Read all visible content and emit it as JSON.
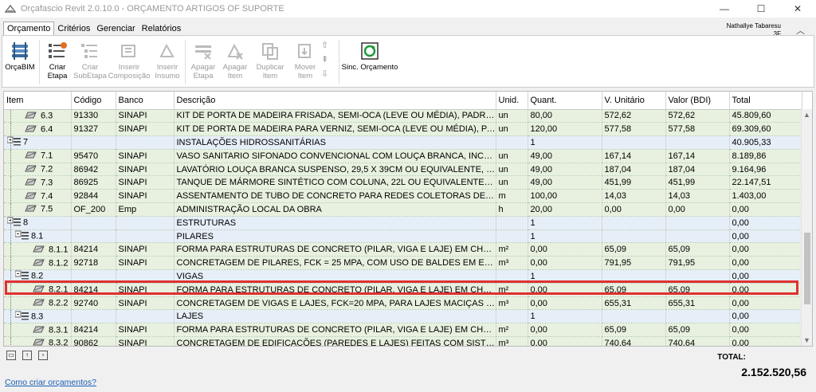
{
  "window": {
    "title": "Orçafascio Revit  2.0.10.0 - ORÇAMENTO ARTIGOS OF SUPORTE",
    "minimize": "—",
    "maximize": "☐",
    "close": "✕"
  },
  "menu": [
    "Orçamento",
    "Critérios",
    "Gerenciar",
    "Relatórios"
  ],
  "user": {
    "name": "Nathallye Tabaresu",
    "sub": "3F"
  },
  "ribbon": {
    "orcabim": "OrçaBIM",
    "criar_etapa": [
      "Criar",
      "Etapa"
    ],
    "criar_subetapa": [
      "Criar",
      "SubEtapa"
    ],
    "inserir_composicao": [
      "Inserir",
      "Composição"
    ],
    "inserir_insumo": [
      "Inserir",
      "Insumo"
    ],
    "apagar_etapa": [
      "Apagar",
      "Etapa"
    ],
    "apagar_item": [
      "Apagar",
      "Item"
    ],
    "duplicar_item": [
      "Duplicar",
      "Item"
    ],
    "mover_item": [
      "Mover",
      "Item"
    ],
    "sinc_orcamento": "Sinc. Orçamento"
  },
  "columns": [
    "Item",
    "Código",
    "Banco",
    "Descrição",
    "Unid.",
    "Quant.",
    "V. Unitário",
    "Valor (BDI)",
    "Total"
  ],
  "rows": [
    {
      "item": "6.3",
      "level": 2,
      "type": "leaf",
      "codigo": "91330",
      "banco": "SINAPI",
      "desc": "KIT DE PORTA DE MADEIRA FRISADA, SEMI-OCA (LEVE OU MÉDIA), PADRÃO MÉDIO, 70...",
      "unid": "un",
      "quant": "80,00",
      "vunit": "572,62",
      "valor": "572,62",
      "total": "45.809,60"
    },
    {
      "item": "6.4",
      "level": 2,
      "type": "leaf",
      "codigo": "91327",
      "banco": "SINAPI",
      "desc": "KIT DE PORTA DE MADEIRA PARA VERNIZ, SEMI-OCA (LEVE OU MÉDIA), PADRÃO POPU...",
      "unid": "un",
      "quant": "120,00",
      "vunit": "577,58",
      "valor": "577,58",
      "total": "69.309,60"
    },
    {
      "item": "7",
      "level": 0,
      "type": "group",
      "codigo": "",
      "banco": "",
      "desc": "INSTALAÇÕES HIDROSSANITÁRIAS",
      "unid": "",
      "quant": "1",
      "vunit": "",
      "valor": "",
      "total": "40.905,33"
    },
    {
      "item": "7.1",
      "level": 2,
      "type": "leaf",
      "codigo": "95470",
      "banco": "SINAPI",
      "desc": "VASO SANITARIO SIFONADO CONVENCIONAL COM LOUÇA BRANCA, INCLUSO CONJU...",
      "unid": "un",
      "quant": "49,00",
      "vunit": "167,14",
      "valor": "167,14",
      "total": "8.189,86"
    },
    {
      "item": "7.2",
      "level": 2,
      "type": "leaf",
      "codigo": "86942",
      "banco": "SINAPI",
      "desc": "LAVATÓRIO LOUÇA BRANCA SUSPENSO, 29,5 X 39CM OU EQUIVALENTE, PADRÃO POP...",
      "unid": "un",
      "quant": "49,00",
      "vunit": "187,04",
      "valor": "187,04",
      "total": "9.164,96"
    },
    {
      "item": "7.3",
      "level": 2,
      "type": "leaf",
      "codigo": "86925",
      "banco": "SINAPI",
      "desc": "TANQUE DE MÁRMORE SINTÉTICO COM COLUNA, 22L OU EQUIVALENTE, INCLUSO SIFÃ...",
      "unid": "un",
      "quant": "49,00",
      "vunit": "451,99",
      "valor": "451,99",
      "total": "22.147,51"
    },
    {
      "item": "7.4",
      "level": 2,
      "type": "leaf",
      "codigo": "92844",
      "banco": "SINAPI",
      "desc": "ASSENTAMENTO DE TUBO DE CONCRETO PARA REDES COLETORAS DE ESGOTO SANITÁ...",
      "unid": "m",
      "quant": "100,00",
      "vunit": "14,03",
      "valor": "14,03",
      "total": "1.403,00"
    },
    {
      "item": "7.5",
      "level": 2,
      "type": "leaf",
      "codigo": "OF_200",
      "banco": "Emp",
      "desc": "ADMINISTRAÇÃO LOCAL DA OBRA",
      "unid": "h",
      "quant": "20,00",
      "vunit": "0,00",
      "valor": "0,00",
      "total": "0,00"
    },
    {
      "item": "8",
      "level": 0,
      "type": "group",
      "codigo": "",
      "banco": "",
      "desc": "ESTRUTURAS",
      "unid": "",
      "quant": "1",
      "vunit": "",
      "valor": "",
      "total": "0,00"
    },
    {
      "item": "8.1",
      "level": 1,
      "type": "group",
      "codigo": "",
      "banco": "",
      "desc": "PILARES",
      "unid": "",
      "quant": "1",
      "vunit": "",
      "valor": "",
      "total": "0,00"
    },
    {
      "item": "8.1.1",
      "level": 3,
      "type": "leaf",
      "codigo": "84214",
      "banco": "SINAPI",
      "desc": "FORMA PARA ESTRUTURAS DE CONCRETO (PILAR, VIGA E LAJE) EM CHAPA DE MADEIR...",
      "unid": "m²",
      "quant": "0,00",
      "vunit": "65,09",
      "valor": "65,09",
      "total": "0,00"
    },
    {
      "item": "8.1.2",
      "level": 3,
      "type": "leaf",
      "codigo": "92718",
      "banco": "SINAPI",
      "desc": "CONCRETAGEM DE PILARES, FCK = 25 MPA,  COM USO DE BALDES EM EDIFICAÇÃO CO...",
      "unid": "m³",
      "quant": "0,00",
      "vunit": "791,95",
      "valor": "791,95",
      "total": "0,00"
    },
    {
      "item": "8.2",
      "level": 1,
      "type": "group",
      "codigo": "",
      "banco": "",
      "desc": "VIGAS",
      "unid": "",
      "quant": "1",
      "vunit": "",
      "valor": "",
      "total": "0,00"
    },
    {
      "item": "8.2.1",
      "level": 3,
      "type": "sel",
      "codigo": "84214",
      "banco": "SINAPI",
      "desc": "FORMA PARA ESTRUTURAS DE CONCRETO (PILAR, VIGA E LAJE) EM CHAPA DE MADEIR...",
      "unid": "m²",
      "quant": "0,00",
      "vunit": "65,09",
      "valor": "65,09",
      "total": "0,00"
    },
    {
      "item": "8.2.2",
      "level": 3,
      "type": "leaf",
      "codigo": "92740",
      "banco": "SINAPI",
      "desc": "CONCRETAGEM DE VIGAS E LAJES, FCK=20 MPA, PARA LAJES MACIÇAS OU NERVURAD...",
      "unid": "m³",
      "quant": "0,00",
      "vunit": "655,31",
      "valor": "655,31",
      "total": "0,00"
    },
    {
      "item": "8.3",
      "level": 1,
      "type": "group",
      "codigo": "",
      "banco": "",
      "desc": "LAJES",
      "unid": "",
      "quant": "1",
      "vunit": "",
      "valor": "",
      "total": "0,00"
    },
    {
      "item": "8.3.1",
      "level": 3,
      "type": "leaf",
      "codigo": "84214",
      "banco": "SINAPI",
      "desc": "FORMA PARA ESTRUTURAS DE CONCRETO (PILAR, VIGA E LAJE) EM CHAPA DE MADEIR...",
      "unid": "m²",
      "quant": "0,00",
      "vunit": "65,09",
      "valor": "65,09",
      "total": "0,00"
    },
    {
      "item": "8.3.2",
      "level": 3,
      "type": "leaf",
      "codigo": "90862",
      "banco": "SINAPI",
      "desc": "CONCRETAGEM DE EDIFICAÇÕES (PAREDES E LAJES) FEITAS COM SISTEMA DE FÔRMAS...",
      "unid": "m³",
      "quant": "0,00",
      "vunit": "740,64",
      "valor": "740,64",
      "total": "0,00"
    }
  ],
  "footer": {
    "total_label": "TOTAL:",
    "total_value": "2.152.520,56",
    "help_link": "Como criar orçamentos?"
  },
  "colors": {
    "leaf_row": "#e8f1df",
    "group_row": "#e6eef8",
    "highlight_border": "#e03030",
    "link": "#1a5fb4"
  }
}
